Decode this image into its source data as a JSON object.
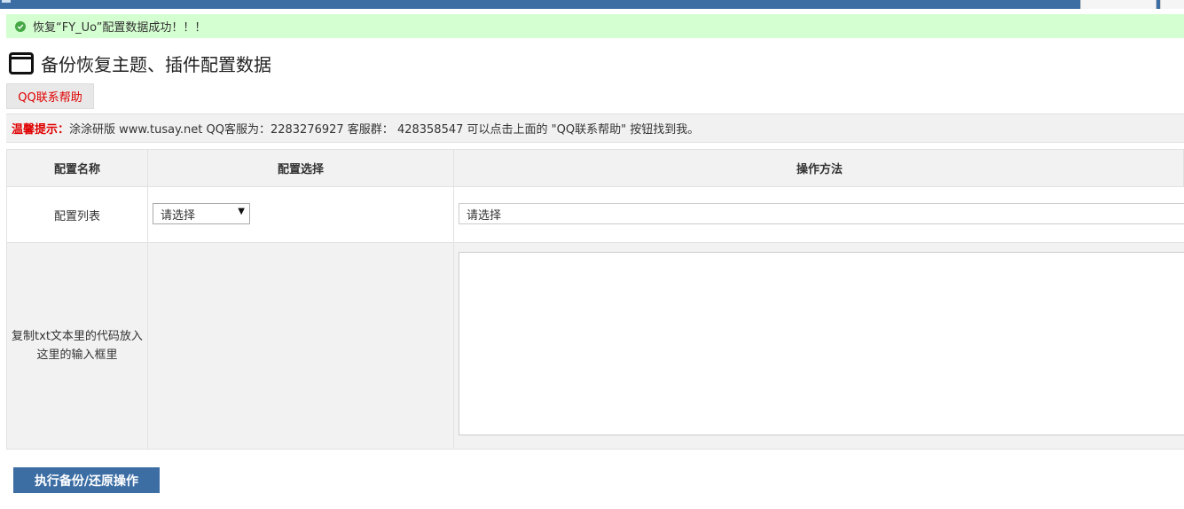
{
  "notice": {
    "success_text": "恢复“FY_Uo”配置数据成功！！！",
    "icon": "check-circle-icon",
    "bg_color": "#d4ffd0"
  },
  "page": {
    "title": "备份恢复主题、插件配置数据",
    "title_icon": "window-icon"
  },
  "buttons": {
    "qq_help": "QQ联系帮助",
    "execute": "执行备份/还原操作"
  },
  "tip": {
    "label": "温馨提示：",
    "text": "涂涂研版 www.tusay.net QQ客服为：2283276927 客服群： 428358547 可以点击上面的 \"QQ联系帮助\" 按钮找到我。"
  },
  "table": {
    "headers": [
      "配置名称",
      "配置选择",
      "操作方法"
    ],
    "row_list": {
      "name": "配置列表",
      "select_value": "请选择",
      "method_value": "请选择"
    },
    "row_code": {
      "label": "复制txt文本里的代码放入这里的输入框里",
      "textarea_value": ""
    }
  },
  "colors": {
    "accent": "#3c6ea4",
    "warning": "#e00000",
    "success": "#45a845"
  }
}
